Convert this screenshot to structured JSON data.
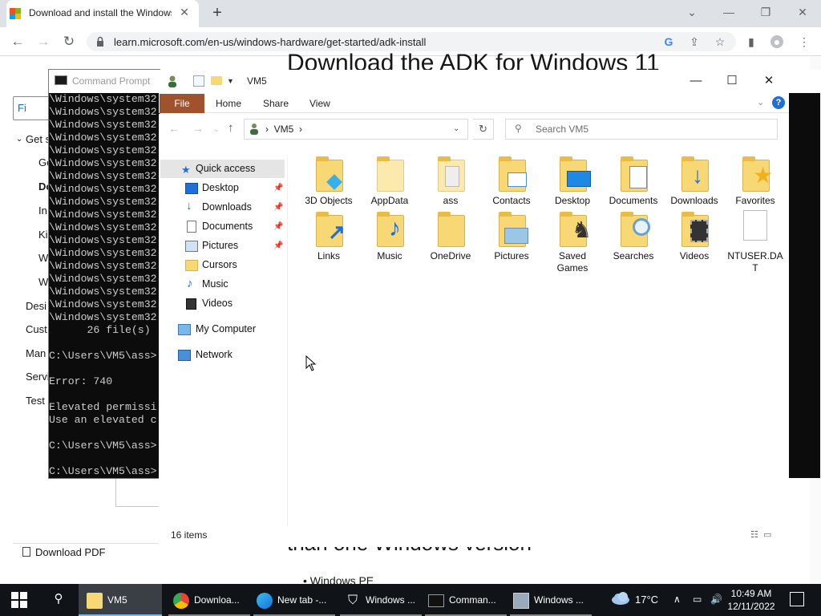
{
  "browser": {
    "tab_title": "Download and install the Windows ADK",
    "url": "learn.microsoft.com/en-us/windows-hardware/get-started/adk-install",
    "new_tab_glyph": "+",
    "tab_close_glyph": "✕",
    "window_controls": [
      "⌄",
      "—",
      "❐",
      "✕"
    ]
  },
  "webpage": {
    "heading": "Download the ADK for Windows 11",
    "filter_label": "Fi",
    "side_nav": [
      "Get s",
      "Ge",
      "Do",
      "In",
      "Ki",
      "W",
      "W",
      "Desi",
      "Cust",
      "Man",
      "Servi",
      "Test"
    ],
    "download_pdf": "Download PDF",
    "sub_text": "than one Windows version",
    "bullet": "•   Windows PE"
  },
  "cmd": {
    "title": "Command Prompt",
    "lines": [
      "\\Windows\\system32",
      "\\Windows\\system32",
      "\\Windows\\system32",
      "\\Windows\\system32",
      "\\Windows\\system32",
      "\\Windows\\system32",
      "\\Windows\\system32",
      "\\Windows\\system32",
      "\\Windows\\system32",
      "\\Windows\\system32",
      "\\Windows\\system32",
      "\\Windows\\system32",
      "\\Windows\\system32",
      "\\Windows\\system32",
      "\\Windows\\system32",
      "\\Windows\\system32",
      "\\Windows\\system32",
      "\\Windows\\system32",
      "      26 file(s)",
      "",
      "C:\\Users\\VM5\\ass>",
      "",
      "Error: 740",
      "",
      "Elevated permissi",
      "Use an elevated c",
      "",
      "C:\\Users\\VM5\\ass>",
      "",
      "C:\\Users\\VM5\\ass>"
    ]
  },
  "explorer": {
    "title": "VM5",
    "ribbon_tabs": [
      "File",
      "Home",
      "Share",
      "View"
    ],
    "address": "VM5",
    "search_placeholder": "Search VM5",
    "nav": {
      "quick_access": "Quick access",
      "pinned": [
        "Desktop",
        "Downloads",
        "Documents",
        "Pictures"
      ],
      "items": [
        "Cursors",
        "Music",
        "Videos"
      ],
      "my_computer": "My Computer",
      "network": "Network"
    },
    "files": [
      "3D Objects",
      "AppData",
      "ass",
      "Contacts",
      "Desktop",
      "Documents",
      "Downloads",
      "Favorites",
      "Links",
      "Music",
      "OneDrive",
      "Pictures",
      "Saved Games",
      "Searches",
      "Videos",
      "NTUSER.DAT"
    ],
    "status": "16 items"
  },
  "taskbar": {
    "items": [
      "VM5",
      "Downloa...",
      "New tab -...",
      "Windows ...",
      "Comman...",
      "Windows ..."
    ],
    "temperature": "17°C",
    "time": "10:49 AM",
    "date": "12/11/2022"
  },
  "colors": {
    "file_tab": "#a0522d",
    "folder": "#f8d775",
    "taskbar": "#101418",
    "accent": "#1e6fd8"
  }
}
